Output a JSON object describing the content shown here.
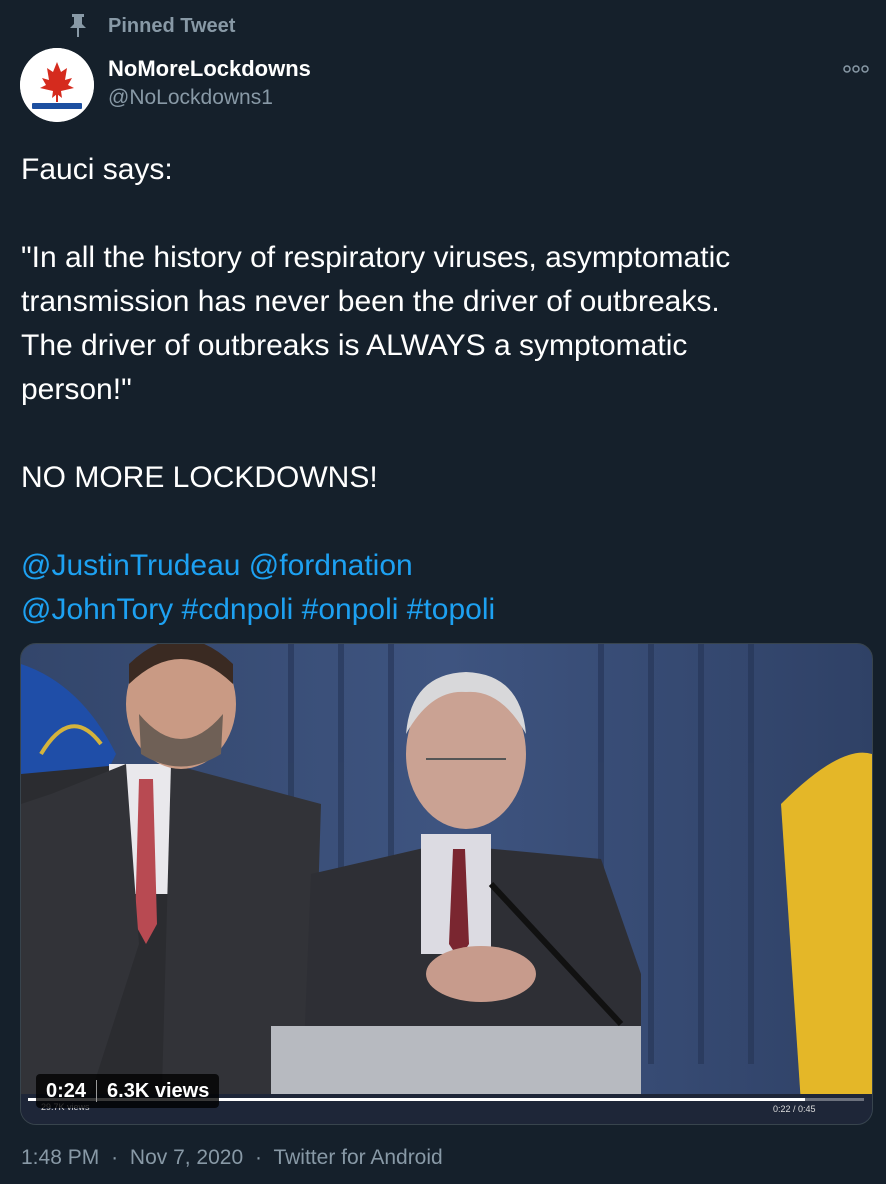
{
  "pinned_label": "Pinned Tweet",
  "author": {
    "display_name": "NoMoreLockdowns",
    "handle": "@NoLockdowns1"
  },
  "tweet": {
    "line1": "Fauci says:",
    "quote_lines": [
      "\"In all the history of respiratory viruses, asymptomatic",
      "transmission has never been the driver of outbreaks.",
      "The driver of outbreaks is ALWAYS a symptomatic",
      "person!\""
    ],
    "shout": "NO MORE LOCKDOWNS!",
    "mentions_line1": [
      "@JustinTrudeau",
      "@fordnation"
    ],
    "mentions_line2": [
      "@JohnTory",
      "#cdnpoli",
      "#onpoli",
      "#topoli"
    ]
  },
  "video": {
    "duration": "0:24",
    "views": "6.3K views",
    "inner_views": "29.7K views",
    "inner_time": "0:22 / 0:45",
    "progress": 0.93
  },
  "footer": {
    "time": "1:48 PM",
    "date": "Nov 7, 2020",
    "source": "Twitter for Android",
    "dot": "·"
  },
  "colors": {
    "background": "#15202b",
    "link": "#1da1f2",
    "secondary": "#8899a6"
  },
  "icons": {
    "pin": "pin-icon",
    "more": "more-icon"
  }
}
